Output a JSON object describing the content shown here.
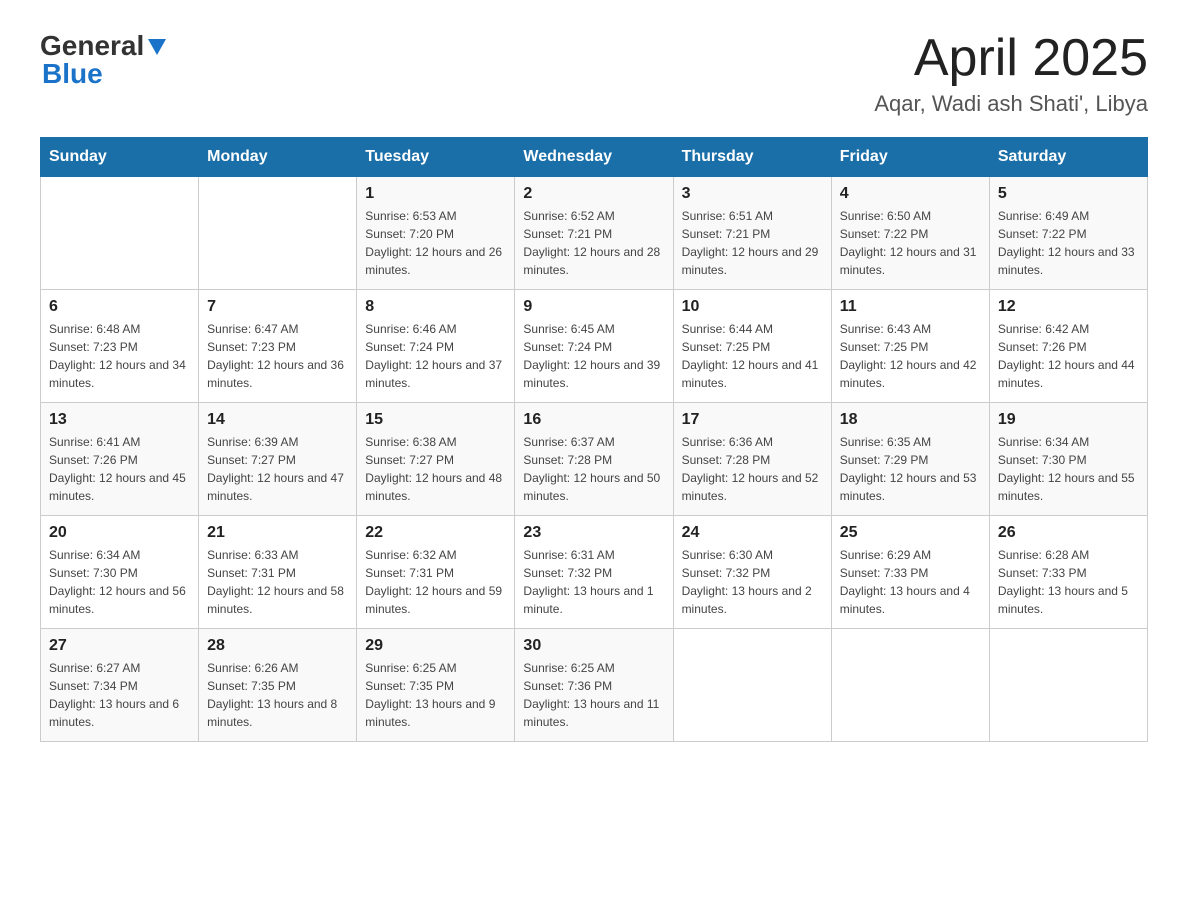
{
  "header": {
    "logo_general": "General",
    "logo_blue": "Blue",
    "month": "April 2025",
    "location": "Aqar, Wadi ash Shati', Libya"
  },
  "weekdays": [
    "Sunday",
    "Monday",
    "Tuesday",
    "Wednesday",
    "Thursday",
    "Friday",
    "Saturday"
  ],
  "weeks": [
    [
      {
        "day": "",
        "sunrise": "",
        "sunset": "",
        "daylight": ""
      },
      {
        "day": "",
        "sunrise": "",
        "sunset": "",
        "daylight": ""
      },
      {
        "day": "1",
        "sunrise": "Sunrise: 6:53 AM",
        "sunset": "Sunset: 7:20 PM",
        "daylight": "Daylight: 12 hours and 26 minutes."
      },
      {
        "day": "2",
        "sunrise": "Sunrise: 6:52 AM",
        "sunset": "Sunset: 7:21 PM",
        "daylight": "Daylight: 12 hours and 28 minutes."
      },
      {
        "day": "3",
        "sunrise": "Sunrise: 6:51 AM",
        "sunset": "Sunset: 7:21 PM",
        "daylight": "Daylight: 12 hours and 29 minutes."
      },
      {
        "day": "4",
        "sunrise": "Sunrise: 6:50 AM",
        "sunset": "Sunset: 7:22 PM",
        "daylight": "Daylight: 12 hours and 31 minutes."
      },
      {
        "day": "5",
        "sunrise": "Sunrise: 6:49 AM",
        "sunset": "Sunset: 7:22 PM",
        "daylight": "Daylight: 12 hours and 33 minutes."
      }
    ],
    [
      {
        "day": "6",
        "sunrise": "Sunrise: 6:48 AM",
        "sunset": "Sunset: 7:23 PM",
        "daylight": "Daylight: 12 hours and 34 minutes."
      },
      {
        "day": "7",
        "sunrise": "Sunrise: 6:47 AM",
        "sunset": "Sunset: 7:23 PM",
        "daylight": "Daylight: 12 hours and 36 minutes."
      },
      {
        "day": "8",
        "sunrise": "Sunrise: 6:46 AM",
        "sunset": "Sunset: 7:24 PM",
        "daylight": "Daylight: 12 hours and 37 minutes."
      },
      {
        "day": "9",
        "sunrise": "Sunrise: 6:45 AM",
        "sunset": "Sunset: 7:24 PM",
        "daylight": "Daylight: 12 hours and 39 minutes."
      },
      {
        "day": "10",
        "sunrise": "Sunrise: 6:44 AM",
        "sunset": "Sunset: 7:25 PM",
        "daylight": "Daylight: 12 hours and 41 minutes."
      },
      {
        "day": "11",
        "sunrise": "Sunrise: 6:43 AM",
        "sunset": "Sunset: 7:25 PM",
        "daylight": "Daylight: 12 hours and 42 minutes."
      },
      {
        "day": "12",
        "sunrise": "Sunrise: 6:42 AM",
        "sunset": "Sunset: 7:26 PM",
        "daylight": "Daylight: 12 hours and 44 minutes."
      }
    ],
    [
      {
        "day": "13",
        "sunrise": "Sunrise: 6:41 AM",
        "sunset": "Sunset: 7:26 PM",
        "daylight": "Daylight: 12 hours and 45 minutes."
      },
      {
        "day": "14",
        "sunrise": "Sunrise: 6:39 AM",
        "sunset": "Sunset: 7:27 PM",
        "daylight": "Daylight: 12 hours and 47 minutes."
      },
      {
        "day": "15",
        "sunrise": "Sunrise: 6:38 AM",
        "sunset": "Sunset: 7:27 PM",
        "daylight": "Daylight: 12 hours and 48 minutes."
      },
      {
        "day": "16",
        "sunrise": "Sunrise: 6:37 AM",
        "sunset": "Sunset: 7:28 PM",
        "daylight": "Daylight: 12 hours and 50 minutes."
      },
      {
        "day": "17",
        "sunrise": "Sunrise: 6:36 AM",
        "sunset": "Sunset: 7:28 PM",
        "daylight": "Daylight: 12 hours and 52 minutes."
      },
      {
        "day": "18",
        "sunrise": "Sunrise: 6:35 AM",
        "sunset": "Sunset: 7:29 PM",
        "daylight": "Daylight: 12 hours and 53 minutes."
      },
      {
        "day": "19",
        "sunrise": "Sunrise: 6:34 AM",
        "sunset": "Sunset: 7:30 PM",
        "daylight": "Daylight: 12 hours and 55 minutes."
      }
    ],
    [
      {
        "day": "20",
        "sunrise": "Sunrise: 6:34 AM",
        "sunset": "Sunset: 7:30 PM",
        "daylight": "Daylight: 12 hours and 56 minutes."
      },
      {
        "day": "21",
        "sunrise": "Sunrise: 6:33 AM",
        "sunset": "Sunset: 7:31 PM",
        "daylight": "Daylight: 12 hours and 58 minutes."
      },
      {
        "day": "22",
        "sunrise": "Sunrise: 6:32 AM",
        "sunset": "Sunset: 7:31 PM",
        "daylight": "Daylight: 12 hours and 59 minutes."
      },
      {
        "day": "23",
        "sunrise": "Sunrise: 6:31 AM",
        "sunset": "Sunset: 7:32 PM",
        "daylight": "Daylight: 13 hours and 1 minute."
      },
      {
        "day": "24",
        "sunrise": "Sunrise: 6:30 AM",
        "sunset": "Sunset: 7:32 PM",
        "daylight": "Daylight: 13 hours and 2 minutes."
      },
      {
        "day": "25",
        "sunrise": "Sunrise: 6:29 AM",
        "sunset": "Sunset: 7:33 PM",
        "daylight": "Daylight: 13 hours and 4 minutes."
      },
      {
        "day": "26",
        "sunrise": "Sunrise: 6:28 AM",
        "sunset": "Sunset: 7:33 PM",
        "daylight": "Daylight: 13 hours and 5 minutes."
      }
    ],
    [
      {
        "day": "27",
        "sunrise": "Sunrise: 6:27 AM",
        "sunset": "Sunset: 7:34 PM",
        "daylight": "Daylight: 13 hours and 6 minutes."
      },
      {
        "day": "28",
        "sunrise": "Sunrise: 6:26 AM",
        "sunset": "Sunset: 7:35 PM",
        "daylight": "Daylight: 13 hours and 8 minutes."
      },
      {
        "day": "29",
        "sunrise": "Sunrise: 6:25 AM",
        "sunset": "Sunset: 7:35 PM",
        "daylight": "Daylight: 13 hours and 9 minutes."
      },
      {
        "day": "30",
        "sunrise": "Sunrise: 6:25 AM",
        "sunset": "Sunset: 7:36 PM",
        "daylight": "Daylight: 13 hours and 11 minutes."
      },
      {
        "day": "",
        "sunrise": "",
        "sunset": "",
        "daylight": ""
      },
      {
        "day": "",
        "sunrise": "",
        "sunset": "",
        "daylight": ""
      },
      {
        "day": "",
        "sunrise": "",
        "sunset": "",
        "daylight": ""
      }
    ]
  ]
}
